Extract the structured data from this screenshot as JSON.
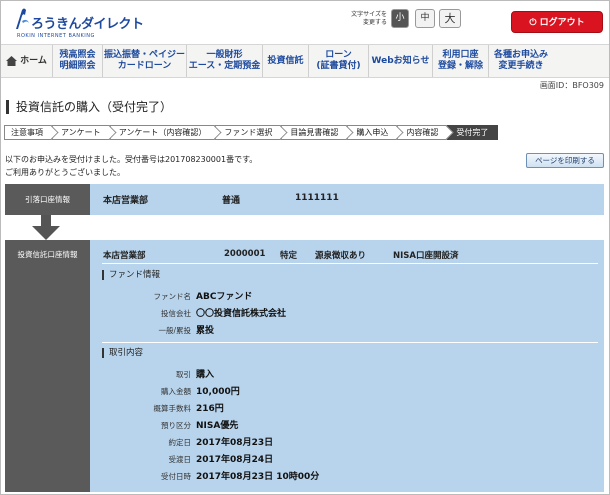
{
  "header": {
    "logo_main": "ろうきんダイレクト",
    "logo_sub": "ROKIN INTERNET BANKING",
    "fontsize_label": "文字サイズを\n変更する",
    "fontsize_small": "小",
    "fontsize_mid": "中",
    "fontsize_large": "大",
    "logout": "ログアウト"
  },
  "nav": {
    "items": [
      {
        "label": "ホーム",
        "icon": "home-icon"
      },
      {
        "label": "残高照会\n明細照会"
      },
      {
        "label": "振込振替・ペイジー\nカードローン"
      },
      {
        "label": "一般財形\nエース・定期預金"
      },
      {
        "label": "投資信託"
      },
      {
        "label": "ローン\n(証書貸付)"
      },
      {
        "label": "Webお知らせ"
      },
      {
        "label": "利用口座\n登録・解除"
      },
      {
        "label": "各種お申込み\n変更手続き"
      }
    ]
  },
  "screen_id": "画面ID：BFO309",
  "page_title": "投資信託の購入（受付完了）",
  "steps": [
    "注意事項",
    "アンケート",
    "アンケート（内容確認）",
    "ファンド選択",
    "目論見書確認",
    "購入申込",
    "内容確認",
    "受付完了"
  ],
  "message": {
    "line1": "以下のお申込みを受付けました。受付番号は201708230001番です。",
    "line2": "ご利用ありがとうございました。"
  },
  "print_button": "ページを印刷する",
  "withdrawal_account": {
    "label": "引落口座情報",
    "branch": "本店営業部",
    "type": "普通",
    "number": "1111111"
  },
  "trust_account": {
    "label": "投資信託口座情報",
    "branch": "本店営業部",
    "number": "2000001",
    "kind": "特定",
    "withholding": "源泉徴収あり",
    "nisa": "NISA口座開設済"
  },
  "fund_info": {
    "title": "ファンド情報",
    "rows": [
      {
        "key": "ファンド名",
        "value": "ABCファンド"
      },
      {
        "key": "投信会社",
        "value": "〇〇投資信託株式会社"
      },
      {
        "key": "一般/累投",
        "value": "累投"
      }
    ]
  },
  "trade_info": {
    "title": "取引内容",
    "rows": [
      {
        "key": "取引",
        "value": "購入"
      },
      {
        "key": "購入金額",
        "value": "10,000円"
      },
      {
        "key": "概算手数料",
        "value": "216円"
      },
      {
        "key": "預り区分",
        "value": "NISA優先"
      },
      {
        "key": "約定日",
        "value": "2017年08月23日"
      },
      {
        "key": "受渡日",
        "value": "2017年08月24日"
      },
      {
        "key": "受付日時",
        "value": "2017年08月23日 10時00分"
      }
    ]
  },
  "colors": {
    "brand_blue": "#1d4a9e",
    "logout_red": "#d9131f",
    "panel_blue": "#b8d4ec",
    "label_gray": "#5a5a5a"
  }
}
